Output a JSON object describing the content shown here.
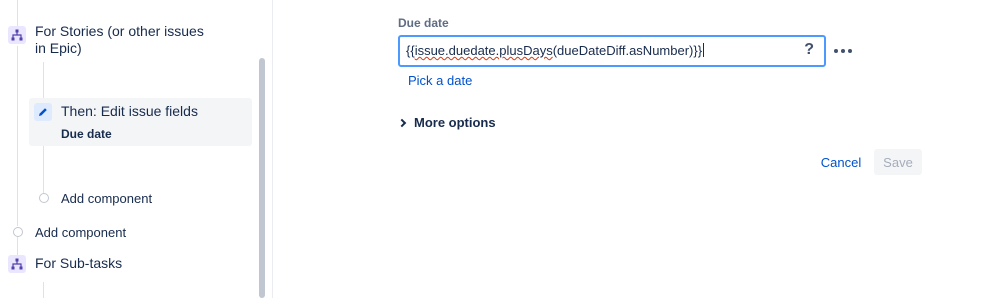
{
  "sidebar": {
    "branch_stories": {
      "label": "For Stories (or other issues in Epic)",
      "icon": "branch-icon"
    },
    "action": {
      "title": "Then: Edit issue fields",
      "subtitle": "Due date",
      "icon": "pencil-icon"
    },
    "add_component_inner": "Add component",
    "add_component_outer": "Add component",
    "branch_subtasks": {
      "label": "For Sub-tasks",
      "icon": "branch-icon"
    }
  },
  "form": {
    "field_label": "Due date",
    "input_value_prefix": "{{",
    "input_value_underlined": "issue.duedate.plusDays",
    "input_value_suffix": "(dueDateDiff.asNumber)}}",
    "help_icon": "?",
    "pick_date_link": "Pick a date",
    "more_options": "More options",
    "cancel_label": "Cancel",
    "save_label": "Save"
  },
  "colors": {
    "accent": "#0052cc",
    "focus_border": "#4c9aff",
    "branch_icon_bg": "#eae6ff",
    "branch_icon_fg": "#5243aa"
  }
}
